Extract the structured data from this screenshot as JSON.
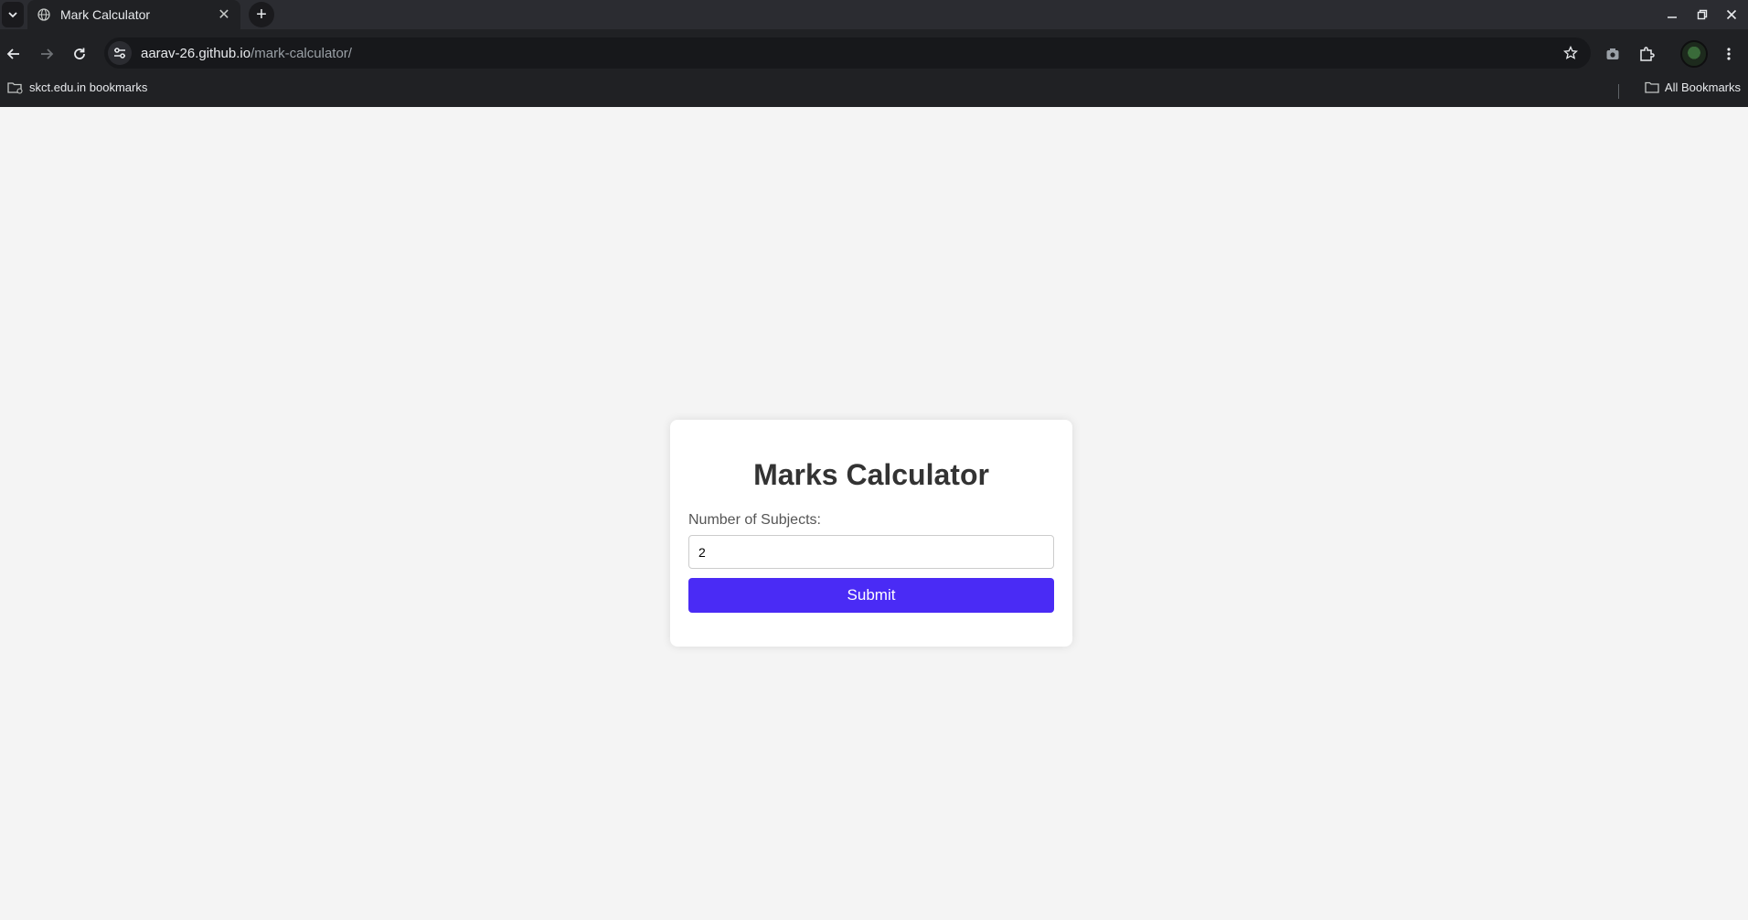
{
  "browser": {
    "tab_title": "Mark Calculator",
    "url_host": "aarav-26.github.io",
    "url_path": "/mark-calculator/",
    "bookmark_folder": "skct.edu.in bookmarks",
    "all_bookmarks": "All Bookmarks"
  },
  "page": {
    "heading": "Marks Calculator",
    "subjects_label": "Number of Subjects:",
    "subjects_value": "2",
    "submit_label": "Submit"
  },
  "colors": {
    "accent": "#4a2bf5",
    "background": "#f4f4f4",
    "chrome": "#202124"
  }
}
